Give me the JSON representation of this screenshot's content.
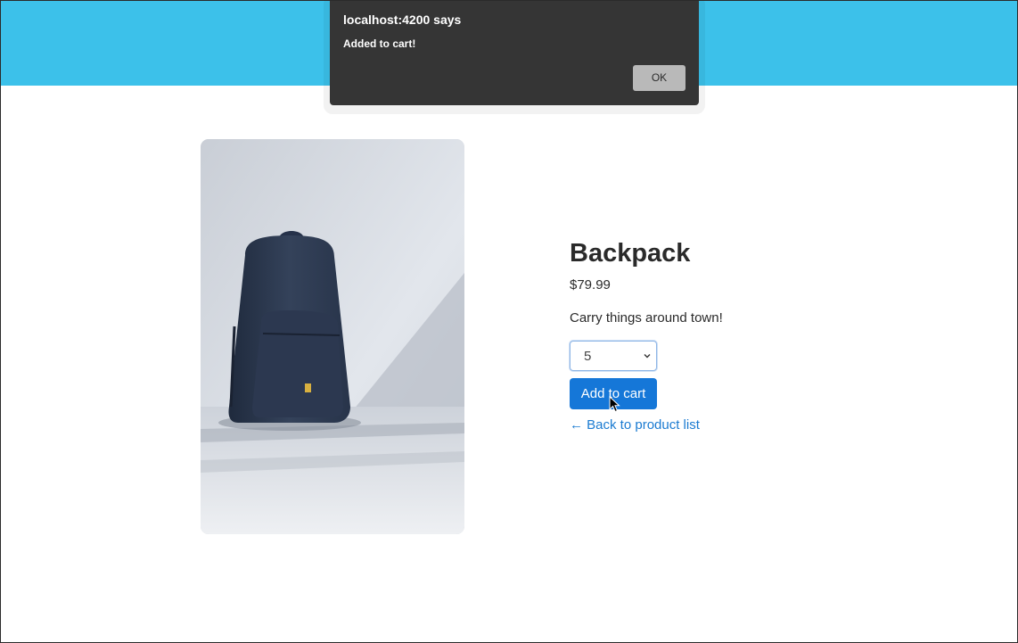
{
  "header": {
    "color": "#3cc1ea"
  },
  "product": {
    "image_subject": "backpack-photo",
    "name": "Backpack",
    "price": "$79.99",
    "description": "Carry things around town!",
    "quantity": {
      "selected": "5"
    },
    "add_button_label": "Add to cart",
    "back_link_label": "← Back to product list"
  },
  "alert": {
    "title": "localhost:4200 says",
    "message": "Added to cart!",
    "ok_label": "OK"
  },
  "colors": {
    "primary_button": "#1577d8",
    "link": "#1b7bd1",
    "dialog_bg": "#353535"
  }
}
